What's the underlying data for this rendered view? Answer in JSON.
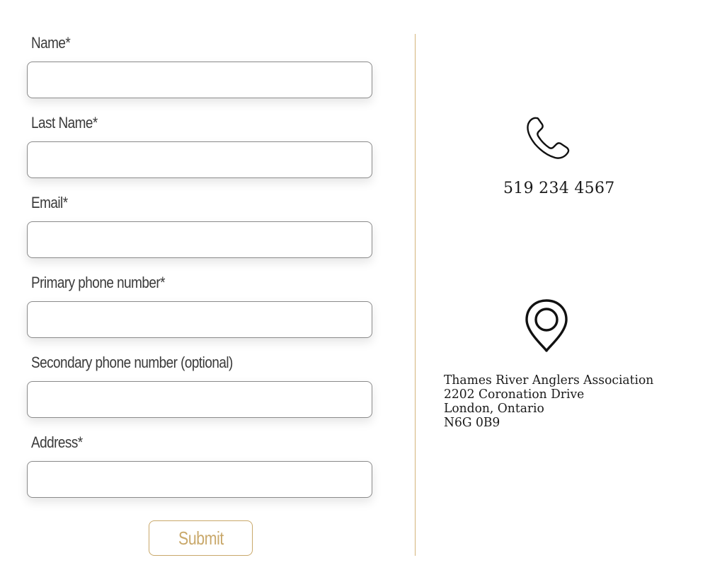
{
  "form": {
    "fields": [
      {
        "label": "Name*",
        "value": "",
        "placeholder": ""
      },
      {
        "label": "Last Name*",
        "value": "",
        "placeholder": ""
      },
      {
        "label": "Email*",
        "value": "",
        "placeholder": ""
      },
      {
        "label": "Primary phone number*",
        "value": "",
        "placeholder": ""
      },
      {
        "label": "Secondary phone number (optional)",
        "value": "",
        "placeholder": ""
      },
      {
        "label": "Address*",
        "value": "",
        "placeholder": ""
      }
    ],
    "submit_label": "Submit"
  },
  "contact": {
    "phone_icon": "phone-icon",
    "phone": "519 234 4567",
    "location_icon": "map-pin-icon",
    "address_lines": [
      "Thames River Anglers Association",
      "2202 Coronation Drive",
      "London, Ontario",
      "N6G 0B9"
    ]
  },
  "colors": {
    "accent": "#c9a86a",
    "divider": "#d4b37a",
    "input_border": "#8a8a8a",
    "label_text": "#3a3a3a"
  }
}
